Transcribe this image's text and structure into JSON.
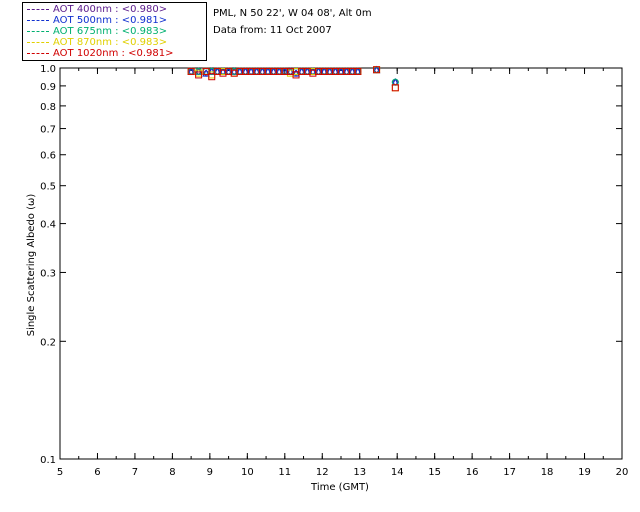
{
  "header": {
    "station": "PML, N 50 22', W 04 08', Alt 0m",
    "date_line": "Data from: 11 Oct 2007"
  },
  "legend": [
    {
      "label": "AOT  400nm : <0.980>",
      "color": "#5a1a8c"
    },
    {
      "label": "AOT  500nm : <0.981>",
      "color": "#1030d0"
    },
    {
      "label": "AOT  675nm : <0.983>",
      "color": "#00b070"
    },
    {
      "label": "AOT  870nm : <0.983>",
      "color": "#e0d000"
    },
    {
      "label": "AOT 1020nm : <0.981>",
      "color": "#d00000"
    }
  ],
  "chart_data": {
    "type": "scatter",
    "xlabel": "Time (GMT)",
    "ylabel": "Single Scattering Albedo (ω)",
    "xlim": [
      5,
      20
    ],
    "ylim": [
      0.1,
      1.0
    ],
    "yscale": "log",
    "xticks": [
      5,
      6,
      7,
      8,
      9,
      10,
      11,
      12,
      13,
      14,
      15,
      16,
      17,
      18,
      19,
      20
    ],
    "yticks": [
      0.1,
      0.2,
      0.3,
      0.4,
      0.5,
      0.6,
      0.7,
      0.8,
      0.9,
      1.0
    ],
    "ytick_labels": [
      "0.1",
      "0.2",
      "0.3",
      "0.4",
      "0.5",
      "0.6",
      "0.7",
      "0.8",
      "0.9",
      "1.0"
    ],
    "x": [
      8.5,
      8.7,
      8.9,
      9.05,
      9.2,
      9.35,
      9.5,
      9.65,
      9.8,
      9.95,
      10.1,
      10.25,
      10.4,
      10.55,
      10.7,
      10.85,
      11.0,
      11.15,
      11.3,
      11.45,
      11.6,
      11.75,
      11.9,
      12.05,
      12.2,
      12.35,
      12.5,
      12.65,
      12.8,
      12.95,
      13.45,
      13.95
    ],
    "series": [
      {
        "name": "AOT  400nm",
        "values": [
          0.98,
          0.98,
          0.97,
          0.98,
          0.98,
          0.98,
          0.98,
          0.98,
          0.98,
          0.98,
          0.98,
          0.98,
          0.98,
          0.98,
          0.98,
          0.98,
          0.98,
          0.98,
          0.97,
          0.98,
          0.98,
          0.98,
          0.98,
          0.98,
          0.98,
          0.98,
          0.98,
          0.98,
          0.98,
          0.98,
          0.99,
          0.92
        ]
      },
      {
        "name": "AOT  500nm",
        "values": [
          0.98,
          0.98,
          0.97,
          0.98,
          0.98,
          0.98,
          0.98,
          0.98,
          0.98,
          0.98,
          0.98,
          0.98,
          0.98,
          0.98,
          0.98,
          0.98,
          0.98,
          0.98,
          0.97,
          0.98,
          0.98,
          0.98,
          0.98,
          0.98,
          0.98,
          0.98,
          0.98,
          0.98,
          0.98,
          0.98,
          0.99,
          0.92
        ]
      },
      {
        "name": "AOT  675nm",
        "values": [
          0.98,
          0.98,
          0.98,
          0.98,
          0.98,
          0.98,
          0.98,
          0.98,
          0.98,
          0.98,
          0.98,
          0.98,
          0.98,
          0.98,
          0.98,
          0.98,
          0.98,
          0.98,
          0.98,
          0.98,
          0.98,
          0.98,
          0.98,
          0.98,
          0.98,
          0.98,
          0.98,
          0.98,
          0.98,
          0.98,
          0.99,
          0.92
        ]
      },
      {
        "name": "AOT  870nm",
        "values": [
          0.98,
          0.97,
          0.98,
          0.96,
          0.98,
          0.98,
          0.98,
          0.97,
          0.98,
          0.98,
          0.98,
          0.98,
          0.98,
          0.98,
          0.98,
          0.98,
          0.98,
          0.97,
          0.98,
          0.98,
          0.98,
          0.98,
          0.98,
          0.98,
          0.98,
          0.98,
          0.98,
          0.98,
          0.98,
          0.98,
          0.99,
          0.89
        ]
      },
      {
        "name": "AOT 1020nm",
        "values": [
          0.98,
          0.96,
          0.98,
          0.95,
          0.98,
          0.97,
          0.98,
          0.97,
          0.98,
          0.98,
          0.98,
          0.98,
          0.98,
          0.98,
          0.98,
          0.98,
          0.98,
          0.98,
          0.96,
          0.98,
          0.98,
          0.97,
          0.98,
          0.98,
          0.98,
          0.98,
          0.98,
          0.98,
          0.98,
          0.98,
          0.99,
          0.89
        ]
      }
    ]
  }
}
